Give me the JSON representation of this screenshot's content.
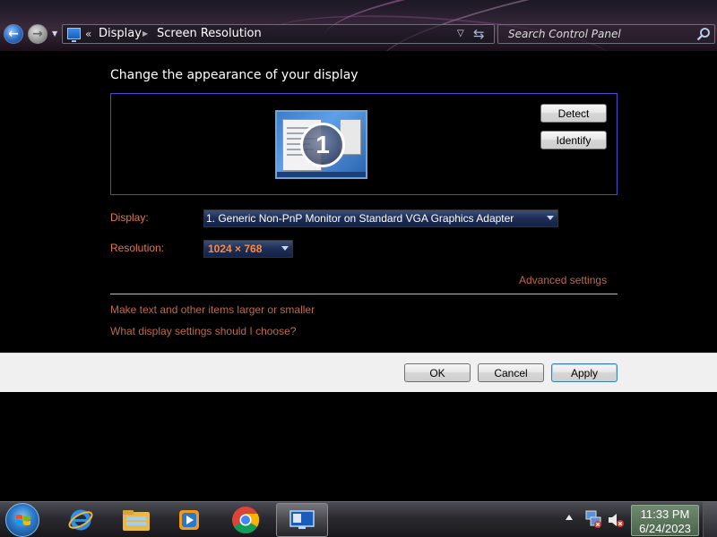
{
  "address_bar": {
    "overflow_chevron": "«",
    "breadcrumb_display": "Display",
    "breadcrumb_screen_resolution": "Screen Resolution",
    "search_placeholder": "Search Control Panel"
  },
  "main": {
    "title": "Change the appearance of your display",
    "monitor_number": "1",
    "detect_label": "Detect",
    "identify_label": "Identify",
    "display_label": "Display:",
    "display_value": "1. Generic Non-PnP Monitor on Standard VGA Graphics Adapter",
    "resolution_label": "Resolution:",
    "resolution_value": "1024 × 768",
    "advanced_link": "Advanced settings",
    "text_size_link": "Make text and other items larger or smaller",
    "choose_link": "What display settings should I choose?"
  },
  "buttons": {
    "ok": "OK",
    "cancel": "Cancel",
    "apply": "Apply"
  },
  "taskbar": {
    "pinned": [
      "start-orb",
      "internet-explorer-icon",
      "windows-explorer-icon",
      "windows-media-player-icon",
      "chrome-icon",
      "display-settings-icon"
    ],
    "clock_time": "11:33 PM",
    "clock_date": "6/24/2023"
  },
  "colors": {
    "accent_link": "#c06848",
    "label_orange": "#e07850",
    "resolution_value": "#ff8a3c",
    "panel_border": "#4a4ad0"
  }
}
